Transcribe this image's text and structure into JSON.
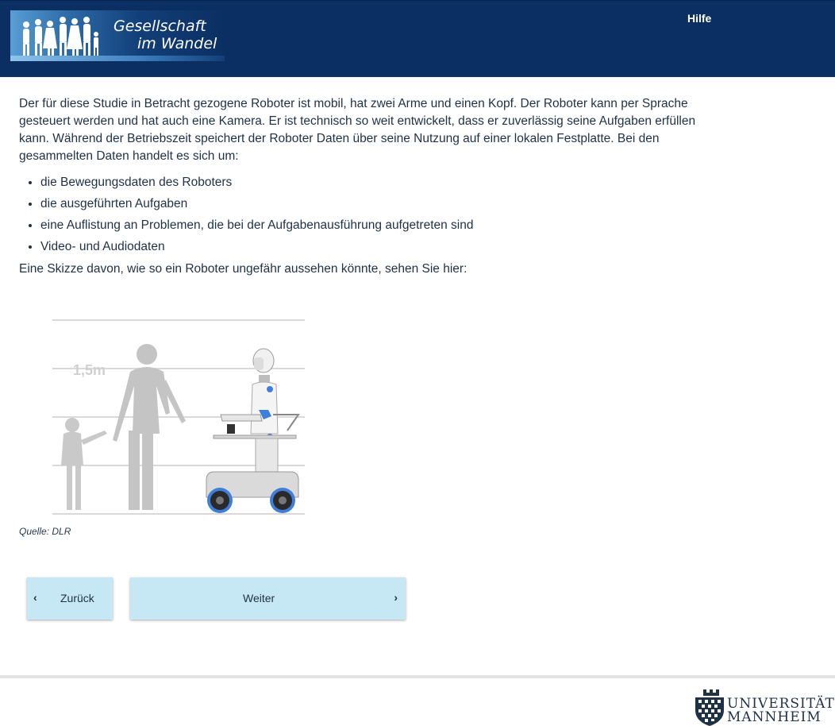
{
  "header": {
    "logo_line1": "Gesellschaft",
    "logo_line2": "im Wandel",
    "help_link": "Hilfe"
  },
  "main": {
    "intro": "Der für diese Studie in Betracht gezogene Roboter ist mobil, hat zwei Arme und einen Kopf. Der Roboter kann per Sprache gesteuert werden und hat auch eine Kamera. Er ist technisch so weit entwickelt, dass er zuverlässig seine Aufgaben erfüllen kann. Während der Betriebszeit speichert der Roboter Daten über seine Nutzung auf einer lokalen Festplatte. Bei den gesammelten Daten handelt es sich um:",
    "bullets": [
      "die Bewegungsdaten des Roboters",
      "die ausgeführten Aufgaben",
      "eine Auflistung an Problemen, die bei der Aufgabenausführung aufgetreten sind",
      "Video- und Audiodaten"
    ],
    "after_text": "Eine Skizze davon, wie so ein Roboter ungefähr aussehen könnte, sehen Sie hier:",
    "figure_label": "1,5m",
    "caption": "Quelle: DLR"
  },
  "nav": {
    "back_label": "Zurück",
    "next_label": "Weiter"
  },
  "footer": {
    "uni_line1": "UNIVERSITÄT",
    "uni_line2": "MANNHEIM"
  },
  "colors": {
    "header_bg": "#0b2f63",
    "button_bg": "#c6e7f4",
    "text": "#1f3147"
  }
}
